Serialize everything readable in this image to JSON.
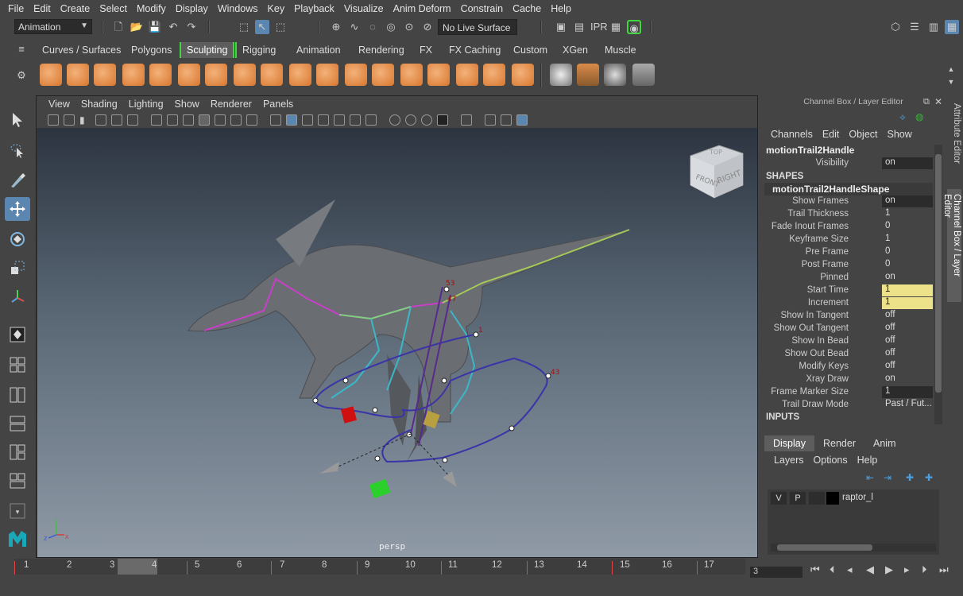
{
  "menubar": [
    "File",
    "Edit",
    "Create",
    "Select",
    "Modify",
    "Display",
    "Windows",
    "Key",
    "Playback",
    "Visualize",
    "Anim Deform",
    "Constrain",
    "Cache",
    "Help"
  ],
  "status": {
    "mode": "Animation",
    "live_surface": "No Live Surface"
  },
  "shelf_tabs": [
    "Curves / Surfaces",
    "Polygons",
    "Sculpting",
    "Rigging",
    "Animation",
    "Rendering",
    "FX",
    "FX Caching",
    "Custom",
    "XGen",
    "Muscle"
  ],
  "shelf_active": "Sculpting",
  "viewport": {
    "menu": [
      "View",
      "Shading",
      "Lighting",
      "Show",
      "Renderer",
      "Panels"
    ],
    "camera_label": "persp",
    "viewcube": {
      "front": "FRONT",
      "right": "RIGHT",
      "top": "TOP"
    },
    "frame_labels": [
      "53",
      "47",
      "43",
      "1"
    ],
    "axis": {
      "y": "y",
      "x": "x",
      "z": "z"
    }
  },
  "channel_box": {
    "title": "Channel Box / Layer Editor",
    "menu": [
      "Channels",
      "Edit",
      "Object",
      "Show"
    ],
    "node": "motionTrail2Handle",
    "visibility_label": "Visibility",
    "visibility_value": "on",
    "shapes_header": "SHAPES",
    "shape_node": "motionTrail2HandleShape",
    "attrs": [
      {
        "label": "Show Frames",
        "value": "on"
      },
      {
        "label": "Trail Thickness",
        "value": "1"
      },
      {
        "label": "Fade Inout Frames",
        "value": "0"
      },
      {
        "label": "Keyframe Size",
        "value": "1"
      },
      {
        "label": "Pre Frame",
        "value": "0"
      },
      {
        "label": "Post Frame",
        "value": "0"
      },
      {
        "label": "Pinned",
        "value": "on"
      },
      {
        "label": "Start Time",
        "value": "1"
      },
      {
        "label": "Increment",
        "value": "1"
      },
      {
        "label": "Show In Tangent",
        "value": "off"
      },
      {
        "label": "Show Out Tangent",
        "value": "off"
      },
      {
        "label": "Show In Bead",
        "value": "off"
      },
      {
        "label": "Show Out Bead",
        "value": "off"
      },
      {
        "label": "Modify Keys",
        "value": "off"
      },
      {
        "label": "Xray Draw",
        "value": "on"
      },
      {
        "label": "Frame Marker Size",
        "value": "1"
      },
      {
        "label": "Trail Draw Mode",
        "value": "Past / Fut..."
      }
    ],
    "inputs_header": "INPUTS"
  },
  "layer_editor": {
    "tabs": [
      "Display",
      "Render",
      "Anim"
    ],
    "menu": [
      "Layers",
      "Options",
      "Help"
    ],
    "layer": {
      "v": "V",
      "p": "P",
      "name": "raptor_l"
    }
  },
  "side_tabs": [
    "Attribute Editor",
    "Channel Box / Layer Editor"
  ],
  "timeline": {
    "ticks": [
      "1",
      "2",
      "3",
      "4",
      "5",
      "6",
      "7",
      "8",
      "9",
      "10",
      "11",
      "12",
      "13",
      "14",
      "15",
      "16",
      "17"
    ],
    "current_field": "3"
  }
}
